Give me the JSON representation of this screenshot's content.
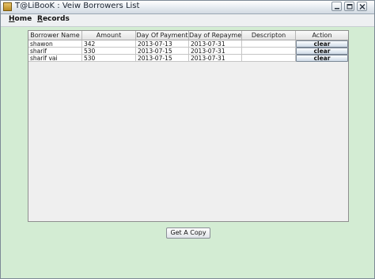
{
  "window": {
    "title": "T@LiBooK : Veiw Borrowers List"
  },
  "menu": {
    "items": [
      {
        "label": "Home"
      },
      {
        "label": "Records"
      }
    ]
  },
  "table": {
    "columns": [
      "Borrower Name",
      "Amount",
      "Day Of Payment",
      "Day of Repayment",
      "Descripton",
      "Action"
    ],
    "rows": [
      {
        "name": "shawon",
        "amount": "342",
        "payment": "2013-07-13",
        "repayment": "2013-07-31",
        "description": "",
        "action": "clear"
      },
      {
        "name": "sharif",
        "amount": "530",
        "payment": "2013-07-15",
        "repayment": "2013-07-31",
        "description": "",
        "action": "clear"
      },
      {
        "name": "sharif vai",
        "amount": "530",
        "payment": "2013-07-15",
        "repayment": "2013-07-31",
        "description": "",
        "action": "clear"
      }
    ]
  },
  "actions": {
    "copy_label": "Get A Copy"
  }
}
